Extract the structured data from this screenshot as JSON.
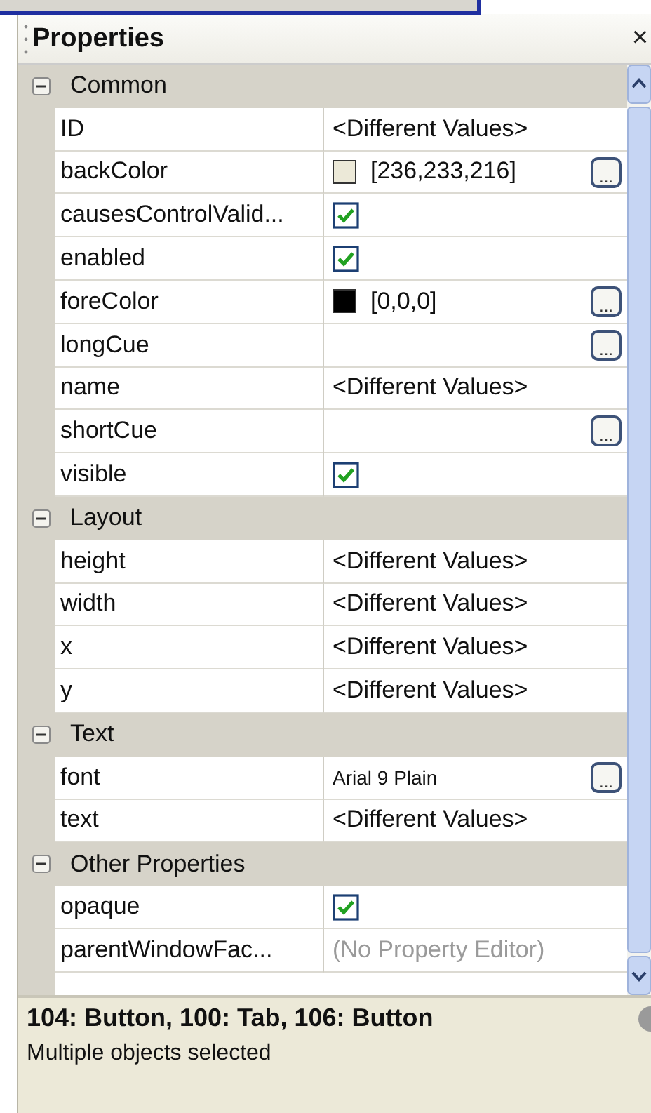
{
  "panel": {
    "title": "Properties",
    "close": "×"
  },
  "categories": [
    {
      "label": "Common",
      "expanded": true,
      "properties": [
        {
          "name": "ID",
          "kind": "text",
          "value": "<Different Values>"
        },
        {
          "name": "backColor",
          "kind": "color",
          "color": "#ece9d8",
          "value": "[236,233,216]",
          "button": "..."
        },
        {
          "name": "causesControlValid...",
          "kind": "check",
          "checked": true
        },
        {
          "name": "enabled",
          "kind": "check",
          "checked": true
        },
        {
          "name": "foreColor",
          "kind": "color",
          "color": "#000000",
          "value": "[0,0,0]",
          "button": "..."
        },
        {
          "name": "longCue",
          "kind": "text",
          "button": "..."
        },
        {
          "name": "name",
          "kind": "text",
          "value": "<Different Values>"
        },
        {
          "name": "shortCue",
          "kind": "text",
          "button": "..."
        },
        {
          "name": "visible",
          "kind": "check",
          "checked": true
        }
      ]
    },
    {
      "label": "Layout",
      "expanded": true,
      "properties": [
        {
          "name": "height",
          "kind": "text",
          "value": "<Different Values>"
        },
        {
          "name": "width",
          "kind": "text",
          "value": "<Different Values>"
        },
        {
          "name": "x",
          "kind": "text",
          "value": "<Different Values>"
        },
        {
          "name": "y",
          "kind": "text",
          "value": "<Different Values>"
        }
      ]
    },
    {
      "label": "Text",
      "expanded": true,
      "properties": [
        {
          "name": "font",
          "kind": "font",
          "value": "Arial 9 Plain",
          "button": "..."
        },
        {
          "name": "text",
          "kind": "text",
          "value": "<Different Values>"
        }
      ]
    },
    {
      "label": "Other Properties",
      "expanded": true,
      "properties": [
        {
          "name": "opaque",
          "kind": "check",
          "checked": true
        },
        {
          "name": "parentWindowFac...",
          "kind": "text",
          "value": "(No Property Editor)",
          "disabled": true
        }
      ]
    }
  ],
  "description": {
    "title": "104: Button, 100: Tab, 106: Button",
    "text": "Multiple objects selected"
  }
}
